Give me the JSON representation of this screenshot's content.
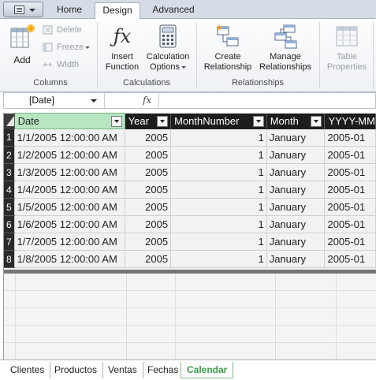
{
  "ribbon_tabs": {
    "home": "Home",
    "design": "Design",
    "advanced": "Advanced"
  },
  "ribbon": {
    "columns": {
      "add": "Add",
      "delete": "Delete",
      "freeze": "Freeze",
      "width": "Width",
      "group": "Columns"
    },
    "calculations": {
      "insert_function": [
        "Insert",
        "Function"
      ],
      "calc_options": [
        "Calculation",
        "Options"
      ],
      "group": "Calculations"
    },
    "relationships": {
      "create": [
        "Create",
        "Relationship"
      ],
      "manage": [
        "Manage",
        "Relationships"
      ],
      "group": "Relationships"
    },
    "table": {
      "properties": [
        "Table",
        "Properties"
      ]
    }
  },
  "formula_bar": {
    "name_box": "[Date]",
    "fx": "fx"
  },
  "table": {
    "columns": [
      "Date",
      "Year",
      "MonthNumber",
      "Month",
      "YYYY-MM"
    ],
    "rows": [
      {
        "n": "1",
        "cells": [
          "1/1/2005 12:00:00 AM",
          "2005",
          "1",
          "January",
          "2005-01"
        ]
      },
      {
        "n": "2",
        "cells": [
          "1/2/2005 12:00:00 AM",
          "2005",
          "1",
          "January",
          "2005-01"
        ]
      },
      {
        "n": "3",
        "cells": [
          "1/3/2005 12:00:00 AM",
          "2005",
          "1",
          "January",
          "2005-01"
        ]
      },
      {
        "n": "4",
        "cells": [
          "1/4/2005 12:00:00 AM",
          "2005",
          "1",
          "January",
          "2005-01"
        ]
      },
      {
        "n": "5",
        "cells": [
          "1/5/2005 12:00:00 AM",
          "2005",
          "1",
          "January",
          "2005-01"
        ]
      },
      {
        "n": "6",
        "cells": [
          "1/6/2005 12:00:00 AM",
          "2005",
          "1",
          "January",
          "2005-01"
        ]
      },
      {
        "n": "7",
        "cells": [
          "1/7/2005 12:00:00 AM",
          "2005",
          "1",
          "January",
          "2005-01"
        ]
      },
      {
        "n": "8",
        "cells": [
          "1/8/2005 12:00:00 AM",
          "2005",
          "1",
          "January",
          "2005-01"
        ]
      }
    ]
  },
  "sheet_tabs": [
    "Clientes",
    "Productos",
    "Ventas",
    "Fechas",
    "Calendar"
  ],
  "active_sheet": "Calendar",
  "colors": {
    "selected_header": "#b8e6c0",
    "active_tab": "#3a9b48",
    "header_bg": "#1d1d1d"
  }
}
